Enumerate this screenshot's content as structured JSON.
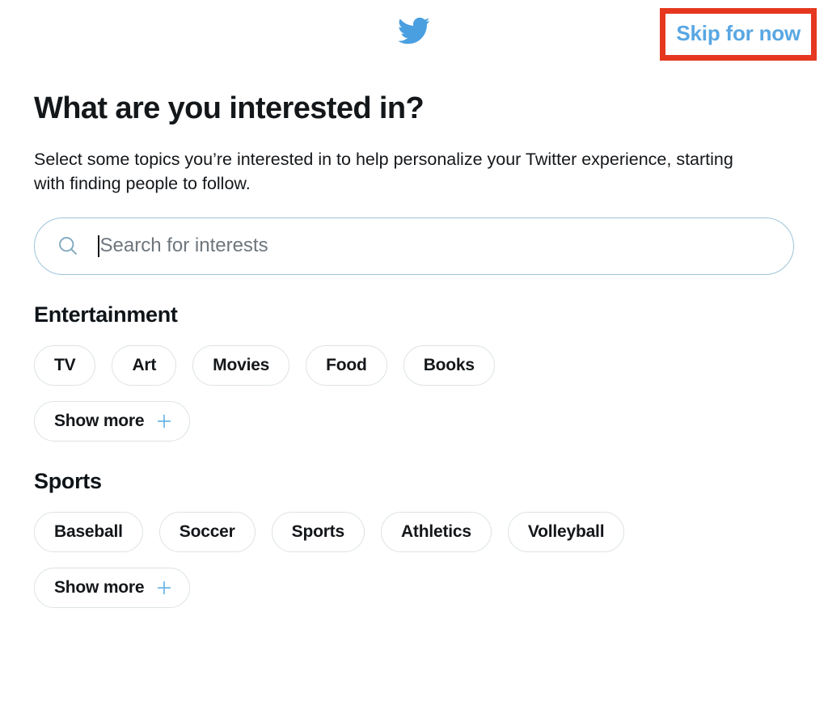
{
  "header": {
    "logo_icon": "twitter-bird-icon",
    "skip_label": "Skip for now",
    "annotation_color": "#e5381f",
    "brand_color": "#58a7e3"
  },
  "main": {
    "title": "What are you interested in?",
    "description": "Select some topics you’re interested in to help personalize your Twitter experience, starting with finding people to follow."
  },
  "search": {
    "placeholder": "Search for interests",
    "value": "",
    "icon": "search-icon",
    "focused": true
  },
  "sections": [
    {
      "title": "Entertainment",
      "chips": [
        "TV",
        "Art",
        "Movies",
        "Food",
        "Books"
      ],
      "show_more_label": "Show more",
      "show_more_icon": "plus-icon"
    },
    {
      "title": "Sports",
      "chips": [
        "Baseball",
        "Soccer",
        "Sports",
        "Athletics",
        "Volleyball"
      ],
      "show_more_label": "Show more",
      "show_more_icon": "plus-icon"
    }
  ]
}
